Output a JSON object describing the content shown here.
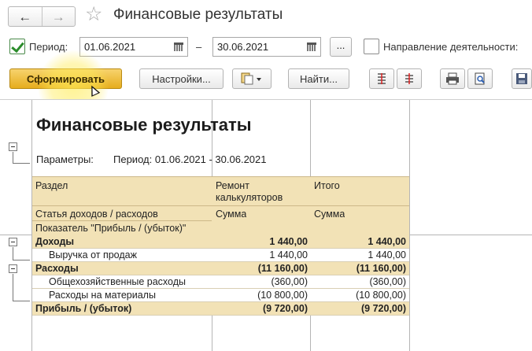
{
  "window": {
    "title": "Финансовые результаты"
  },
  "period_row": {
    "period_label": "Период:",
    "date_from": "01.06.2021",
    "dash": "–",
    "date_to": "30.06.2021",
    "select_label": "...",
    "direction_label": "Направление деятельности:"
  },
  "toolbar": {
    "generate_label": "Сформировать",
    "settings_label": "Настройки...",
    "find_label": "Найти..."
  },
  "report": {
    "title": "Финансовые результаты",
    "params_label": "Параметры:",
    "params_value": "Период: 01.06.2021 - 30.06.2021",
    "header": {
      "section": "Раздел",
      "col1_title_line1": "Ремонт",
      "col1_title_line2": "калькуляторов",
      "col2_title": "Итого",
      "article": "Статья доходов / расходов",
      "col1_sum": "Сумма",
      "col2_sum": "Сумма",
      "indicator": "Показатель \"Прибыль / (убыток)\""
    },
    "rows": [
      {
        "label": "Доходы",
        "v1": "1 440,00",
        "v2": "1 440,00",
        "bold": true
      },
      {
        "label": "Выручка от продаж",
        "v1": "1 440,00",
        "v2": "1 440,00",
        "bold": false
      },
      {
        "label": "Расходы",
        "v1": "(11 160,00)",
        "v2": "(11 160,00)",
        "bold": true
      },
      {
        "label": "Общехозяйственные расходы",
        "v1": "(360,00)",
        "v2": "(360,00)",
        "bold": false
      },
      {
        "label": "Расходы на материалы",
        "v1": "(10 800,00)",
        "v2": "(10 800,00)",
        "bold": false
      },
      {
        "label": "Прибыль / (убыток)",
        "v1": "(9 720,00)",
        "v2": "(9 720,00)",
        "bold": true
      }
    ]
  },
  "colors": {
    "accent": "#e6ad1d",
    "header_fill": "#f2e2b6"
  }
}
